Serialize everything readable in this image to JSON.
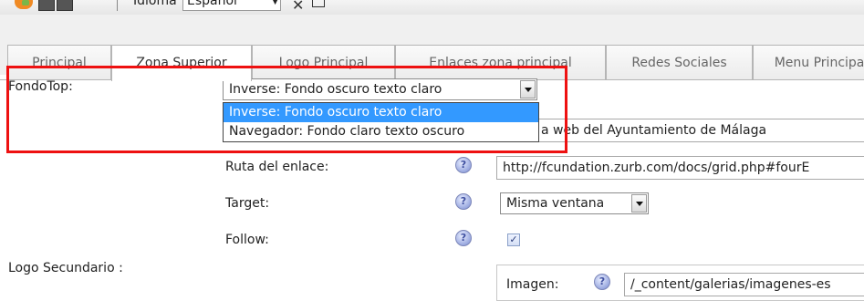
{
  "toolbar": {
    "idioma_label": "Idioma",
    "language_value": "Español",
    "icons": [
      "rss-feed-icon",
      "save-icon",
      "save-all-icon",
      "tools-icon",
      "window-icon"
    ]
  },
  "tabs": [
    {
      "label": "Principal",
      "active": false
    },
    {
      "label": "Zona Superior",
      "active": true
    },
    {
      "label": "Logo Principal",
      "active": false
    },
    {
      "label": "Enlaces zona principal",
      "active": false
    },
    {
      "label": "Redes Sociales",
      "active": false
    },
    {
      "label": "Menu Principal",
      "active": false
    }
  ],
  "form": {
    "fondotop_label": "FondoTop:",
    "fondotop_value": "Inverse: Fondo oscuro texto claro",
    "fondotop_options": [
      "Inverse: Fondo oscuro texto claro",
      "Navegador: Fondo claro texto oscuro"
    ],
    "title_value": "a web del Ayuntamiento de Málaga",
    "ruta_label": "Ruta del enlace:",
    "ruta_value": "http://fcundation.zurb.com/docs/grid.php#fourE",
    "target_label": "Target:",
    "target_value": "Misma ventana",
    "follow_label": "Follow:",
    "follow_checked": true,
    "logo_secundario_label": "Logo Secundario :",
    "imagen_label": "Imagen:",
    "imagen_value": "/_content/galerias/imagenes-es"
  },
  "colors": {
    "highlight_border": "#ee1111",
    "selected_option": "#3399ff"
  }
}
